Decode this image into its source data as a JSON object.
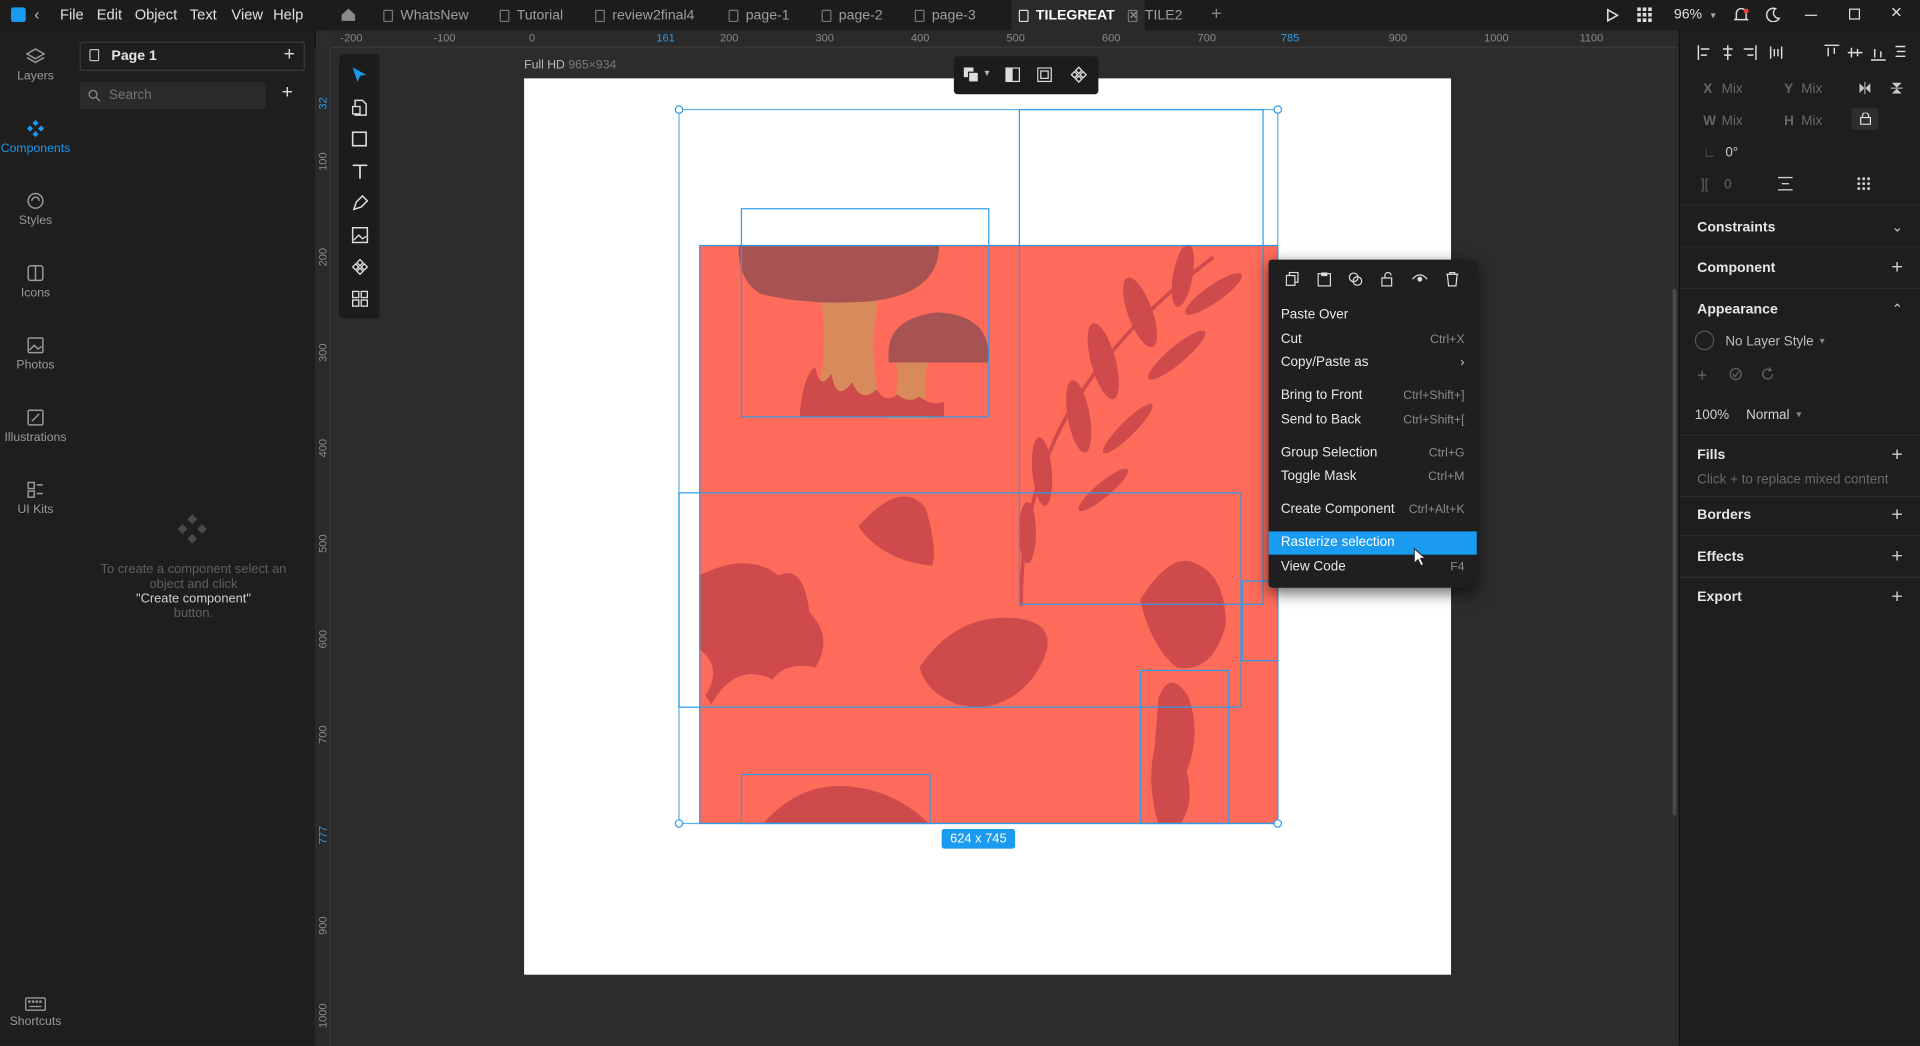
{
  "titlebar": {
    "menus": [
      "File",
      "Edit",
      "Object",
      "Text",
      "View",
      "Help"
    ],
    "tabs": [
      {
        "label": "WhatsNew",
        "active": false
      },
      {
        "label": "Tutorial",
        "active": false
      },
      {
        "label": "review2final4",
        "active": false
      },
      {
        "label": "page-1",
        "active": false
      },
      {
        "label": "page-2",
        "active": false
      },
      {
        "label": "page-3",
        "active": false
      },
      {
        "label": "TILEGREAT",
        "active": true
      },
      {
        "label": "TILE2",
        "active": false
      }
    ],
    "zoom": "96%"
  },
  "leftnav": {
    "items": [
      {
        "label": "Layers",
        "icon": "layers-icon",
        "active": false
      },
      {
        "label": "Components",
        "icon": "components-icon",
        "active": true
      },
      {
        "label": "Styles",
        "icon": "styles-icon",
        "active": false
      },
      {
        "label": "Icons",
        "icon": "icons-icon",
        "active": false
      },
      {
        "label": "Photos",
        "icon": "photos-icon",
        "active": false
      },
      {
        "label": "Illustrations",
        "icon": "illustrations-icon",
        "active": false
      },
      {
        "label": "UI Kits",
        "icon": "ui-kits-icon",
        "active": false
      }
    ],
    "shortcuts": "Shortcuts"
  },
  "components_panel": {
    "page_name": "Page 1",
    "search_placeholder": "Search",
    "empty_line1": "To create a component select an",
    "empty_line2": "object and click",
    "empty_line3": "\"Create component\"",
    "empty_line4": "button."
  },
  "rulers": {
    "top": [
      "-200",
      "-100",
      "0",
      "161",
      "200",
      "300",
      "400",
      "500",
      "600",
      "700",
      "785",
      "900",
      "1000",
      "1100"
    ],
    "left": [
      "32",
      "100",
      "200",
      "300",
      "400",
      "500",
      "600",
      "700",
      "777",
      "900",
      "1000"
    ]
  },
  "canvas": {
    "frame_label": "Full HD",
    "frame_size": "965×934",
    "selection_size": "624 x 745",
    "tile_color": "#fe6b5b",
    "shape_color": "#cf4a4a"
  },
  "context_menu": {
    "items": [
      {
        "label": "Paste Over",
        "shortcut": ""
      },
      {
        "label": "Cut",
        "shortcut": "Ctrl+X"
      },
      {
        "label": "Copy/Paste as",
        "shortcut": ""
      },
      {
        "label": "Bring to Front",
        "shortcut": "Ctrl+Shift+]"
      },
      {
        "label": "Send to Back",
        "shortcut": "Ctrl+Shift+["
      },
      {
        "label": "Group Selection",
        "shortcut": "Ctrl+G"
      },
      {
        "label": "Toggle Mask",
        "shortcut": "Ctrl+M"
      },
      {
        "label": "Create Component",
        "shortcut": "Ctrl+Alt+K"
      },
      {
        "label": "Rasterize selection",
        "shortcut": ""
      },
      {
        "label": "View Code",
        "shortcut": "F4"
      }
    ]
  },
  "right_panel": {
    "x_label": "X",
    "x_value": "Mix",
    "y_label": "Y",
    "y_value": "Mix",
    "w_label": "W",
    "w_value": "Mix",
    "h_label": "H",
    "h_value": "Mix",
    "rotation": "0°",
    "radius": "0",
    "constraints": "Constraints",
    "component": "Component",
    "appearance": "Appearance",
    "layer_style": "No Layer Style",
    "opacity": "100%",
    "blend": "Normal",
    "fills": "Fills",
    "fills_hint": "Click + to replace mixed content",
    "borders": "Borders",
    "effects": "Effects",
    "export": "Export"
  },
  "accent_color": "#1a9bf0"
}
